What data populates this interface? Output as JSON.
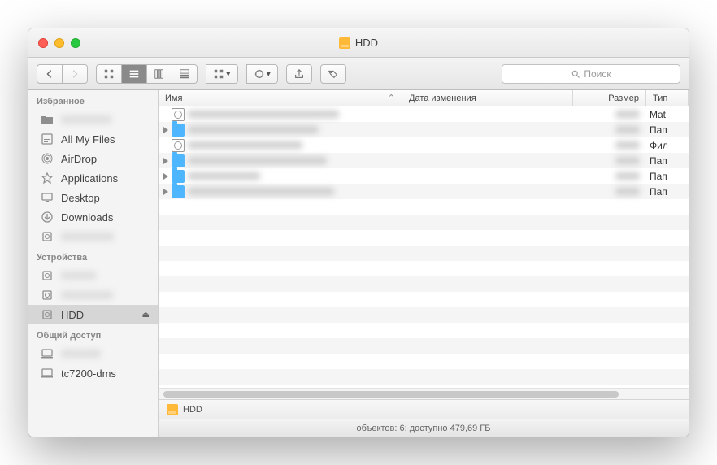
{
  "window": {
    "title": "HDD"
  },
  "toolbar": {
    "search_placeholder": "Поиск"
  },
  "sidebar": {
    "sections": [
      {
        "header": "Избранное",
        "items": [
          {
            "icon": "folder",
            "label": "",
            "blurred": true
          },
          {
            "icon": "allfiles",
            "label": "All My Files"
          },
          {
            "icon": "airdrop",
            "label": "AirDrop"
          },
          {
            "icon": "apps",
            "label": "Applications"
          },
          {
            "icon": "desktop",
            "label": "Desktop"
          },
          {
            "icon": "downloads",
            "label": "Downloads"
          },
          {
            "icon": "disk",
            "label": "",
            "blurred": true
          }
        ]
      },
      {
        "header": "Устройства",
        "items": [
          {
            "icon": "disk",
            "label": "",
            "blurred": true
          },
          {
            "icon": "disk",
            "label": "",
            "blurred": true
          },
          {
            "icon": "disk",
            "label": "HDD",
            "selected": true,
            "eject": true
          }
        ]
      },
      {
        "header": "Общий доступ",
        "items": [
          {
            "icon": "computer",
            "label": "",
            "blurred": true
          },
          {
            "icon": "computer",
            "label": "tc7200-dms"
          }
        ]
      }
    ]
  },
  "columns": {
    "name": "Имя",
    "date": "Дата изменения",
    "size": "Размер",
    "type": "Тип"
  },
  "rows": [
    {
      "expandable": false,
      "icon": "disk",
      "type": "Mat"
    },
    {
      "expandable": true,
      "icon": "folder",
      "type": "Пап"
    },
    {
      "expandable": false,
      "icon": "disk",
      "type": "Фил"
    },
    {
      "expandable": true,
      "icon": "folder",
      "type": "Пап"
    },
    {
      "expandable": true,
      "icon": "folder",
      "type": "Пап"
    },
    {
      "expandable": true,
      "icon": "folder",
      "type": "Пап"
    }
  ],
  "pathbar": {
    "label": "HDD"
  },
  "status": "объектов: 6; доступно 479,69 ГБ"
}
